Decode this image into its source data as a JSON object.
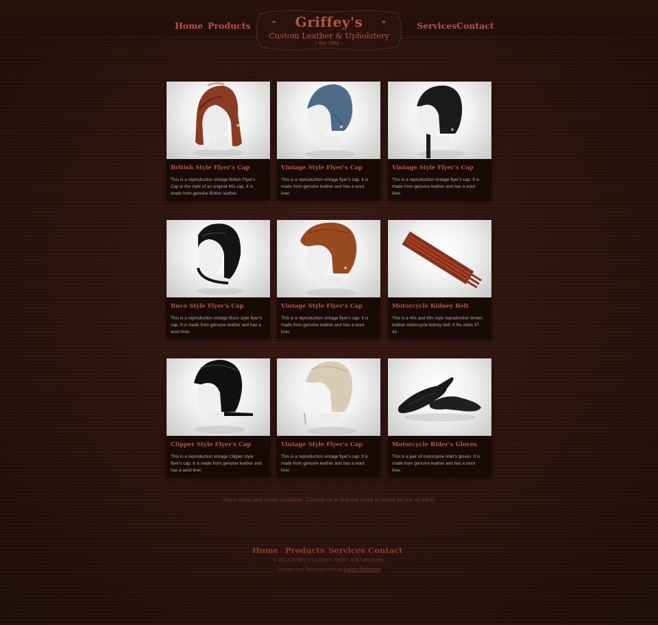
{
  "nav": {
    "home": "Home",
    "products": "Products",
    "services": "Services",
    "contact": "Contact"
  },
  "logo": {
    "title": "Griffey's",
    "subtitle": "Custom Leather & Upholstery",
    "established": "~ Est. 1962 ~"
  },
  "products": [
    {
      "title": "British Style Flyer's Cap",
      "description": "This is a reproduction vintage British Flyer's Cap in the style of an original 40s cap. It is made from genuine British leather.",
      "image": "brown-flyer-cap-icon"
    },
    {
      "title": "Vintage Style Flyer's Cap",
      "description": "This is a reproduction vintage flyer's cap. It is made from genuine leather and has a wool liner.",
      "image": "blue-flyer-cap-icon"
    },
    {
      "title": "Vintage Style Flyer's Cap",
      "description": "This is a reproduction vintage flyer's cap. It is made from genuine leather and has a wool liner.",
      "image": "black-flyer-cap-icon"
    },
    {
      "title": "Buco Style Flyer's Cap",
      "description": "This is a reproduction vintage Buco style flyer's cap. It is made from genuine leather and has a wool liner.",
      "image": "black-buco-cap-icon"
    },
    {
      "title": "Vintage Style Flyer's Cap",
      "description": "This is a reproduction vintage flyer's cap. It is made from genuine leather and has a wool liner.",
      "image": "tan-flyer-cap-icon"
    },
    {
      "title": "Motorcycle Kidney Belt",
      "description": "This is a 40s and 50s style reproduction brown leather motorcycle kidney belt. It fits sizes 37-41.",
      "image": "kidney-belt-icon"
    },
    {
      "title": "Clipper Style Flyer's Cap",
      "description": "This is a reproduction vintage Clipper style flyer's cap. It is made from genuine leather and has a wool liner.",
      "image": "clipper-cap-icon"
    },
    {
      "title": "Vintage Style Flyer's Cap",
      "description": "This is a reproduction vintage flyer's cap. It is made from genuine leather and has a wool liner.",
      "image": "cream-flyer-cap-icon"
    },
    {
      "title": "Motorcycle Rider's Gloves",
      "description": "This is a pair of motorcycle rider's gloves. It is made from genuine leather and has a wool liner.",
      "image": "gloves-icon"
    }
  ],
  "note": "Many sizes and colors available. Contact us to find out more or check us out on eBay",
  "footer": {
    "home": "Home",
    "products": "Products",
    "services": "Services",
    "contact": "Contact",
    "copyright": "© 2013 Griffey's Custom Leather and Upholstery",
    "credit_prefix": "Design and Development by ",
    "credit_name": "Aaron Etcheson"
  },
  "colors": {
    "accent": "#b4573a",
    "background": "#2b130d",
    "card": "#170a07"
  }
}
